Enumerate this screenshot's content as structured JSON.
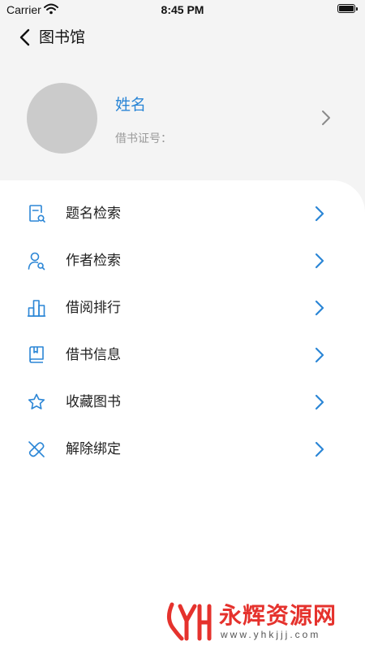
{
  "status_bar": {
    "carrier": "Carrier",
    "time": "8:45 PM"
  },
  "nav": {
    "title": "图书馆"
  },
  "profile": {
    "name": "姓名",
    "card_label": "借书证号：",
    "card_value": ""
  },
  "menu": {
    "items": [
      {
        "label": "题名检索",
        "icon": "book-search-icon"
      },
      {
        "label": "作者检索",
        "icon": "person-search-icon"
      },
      {
        "label": "借阅排行",
        "icon": "bar-chart-icon"
      },
      {
        "label": "借书信息",
        "icon": "book-icon"
      },
      {
        "label": "收藏图书",
        "icon": "star-icon"
      },
      {
        "label": "解除绑定",
        "icon": "unlink-icon"
      }
    ]
  },
  "watermark": {
    "brand": "永辉资源网",
    "site": "www.yhkjjj.com"
  },
  "colors": {
    "accent": "#2b86d6",
    "background": "#f4f4f4",
    "card": "#ffffff",
    "watermark": "#e5322d"
  }
}
